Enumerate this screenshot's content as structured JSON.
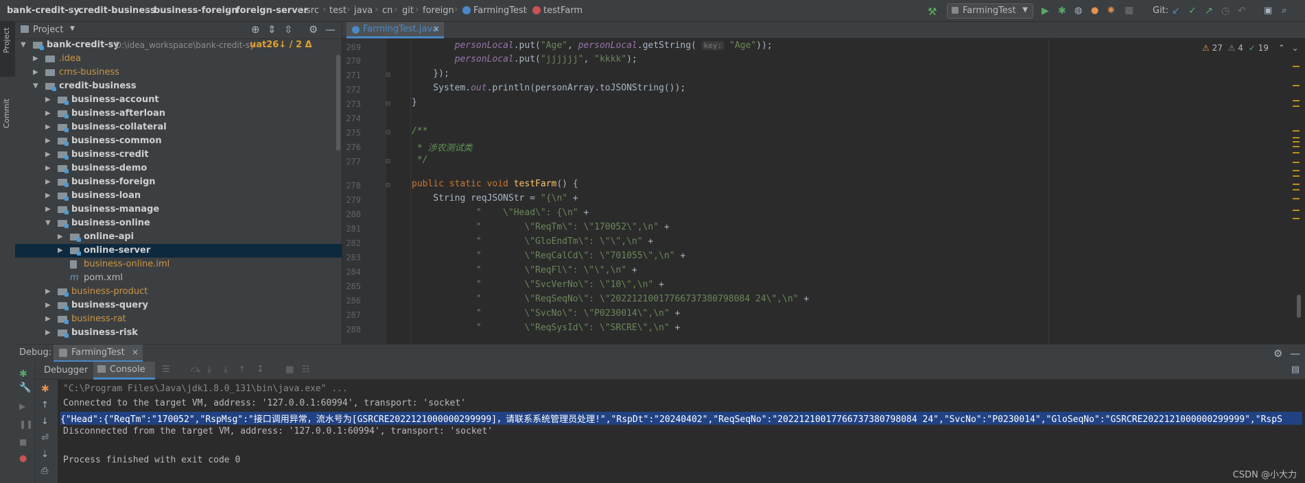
{
  "breadcrumbs": [
    "bank-credit-sy",
    "credit-business",
    "business-foreign",
    "foreign-server",
    "src",
    "test",
    "java",
    "cn",
    "git",
    "foreign",
    "FarmingTest",
    "testFarm"
  ],
  "toolbar": {
    "run_config": "FarmingTest",
    "git_label": "Git:"
  },
  "sidebar": {
    "project_label": "Project",
    "commit_label": "Commit"
  },
  "project": {
    "header": "Project",
    "rows": [
      {
        "label": "bank-credit-sy",
        "extra": "D:\\idea_workspace\\bank-credit-sy",
        "branch": "uat26↓ / 2 Δ",
        "color": "#d0d0d0"
      },
      {
        "label": ".idea",
        "color": "#cc9547"
      },
      {
        "label": "cms-business",
        "color": "#cc9547"
      },
      {
        "label": "credit-business",
        "color": "#d0d0d0"
      },
      {
        "label": "business-account",
        "color": "#d0d0d0"
      },
      {
        "label": "business-afterloan",
        "color": "#d0d0d0"
      },
      {
        "label": "business-collateral",
        "color": "#d0d0d0"
      },
      {
        "label": "business-common",
        "color": "#d0d0d0"
      },
      {
        "label": "business-credit",
        "color": "#d0d0d0"
      },
      {
        "label": "business-demo",
        "color": "#d0d0d0"
      },
      {
        "label": "business-foreign",
        "color": "#d0d0d0"
      },
      {
        "label": "business-loan",
        "color": "#d0d0d0"
      },
      {
        "label": "business-manage",
        "color": "#d0d0d0"
      },
      {
        "label": "business-online",
        "color": "#d0d0d0"
      },
      {
        "label": "online-api",
        "color": "#d0d0d0"
      },
      {
        "label": "online-server",
        "color": "#d0d0d0"
      },
      {
        "label": "business-online.iml",
        "color": "#cc9547"
      },
      {
        "label": "pom.xml",
        "color": "#bbbbbb"
      },
      {
        "label": "business-product",
        "color": "#cc9547"
      },
      {
        "label": "business-query",
        "color": "#d0d0d0"
      },
      {
        "label": "business-rat",
        "color": "#cc9547"
      },
      {
        "label": "business-risk",
        "color": "#d0d0d0"
      }
    ]
  },
  "editor": {
    "tab": "FarmingTest.java",
    "inspections": {
      "warnings": "27",
      "weak": "4",
      "typos": "19"
    },
    "line_numbers": [
      "269",
      "270",
      "271",
      "272",
      "273",
      "274",
      "275",
      "276",
      "277",
      "278",
      "279",
      "280",
      "281",
      "282",
      "283",
      "284",
      "285",
      "286",
      "287",
      "288"
    ],
    "hint": "key:"
  },
  "debug": {
    "label": "Debug:",
    "session": "FarmingTest",
    "tab_debugger": "Debugger",
    "tab_console": "Console"
  },
  "console": {
    "lines": [
      "\"C:\\Program Files\\Java\\jdk1.8.0_131\\bin\\java.exe\" ...",
      "Connected to the target VM, address: '127.0.0.1:60994', transport: 'socket'",
      "{\"Head\":{\"ReqTm\":\"170052\",\"RspMsg\":\"接口调用异常，流水号为[GSRCRE2022121000000299999]，请联系系统管理员处理!\",\"RspDt\":\"20240402\",\"ReqSeqNo\":\"20221210017766737380798084 24\",\"SvcNo\":\"P0230014\",\"GloSeqNo\":\"GSRCRE2022121000000299999\",\"RspS",
      "Disconnected from the target VM, address: '127.0.0.1:60994', transport: 'socket'",
      "",
      "Process finished with exit code 0"
    ]
  },
  "watermark": "CSDN @小大力",
  "colors": {
    "accent": "#4a88c7",
    "selection": "#214283"
  }
}
